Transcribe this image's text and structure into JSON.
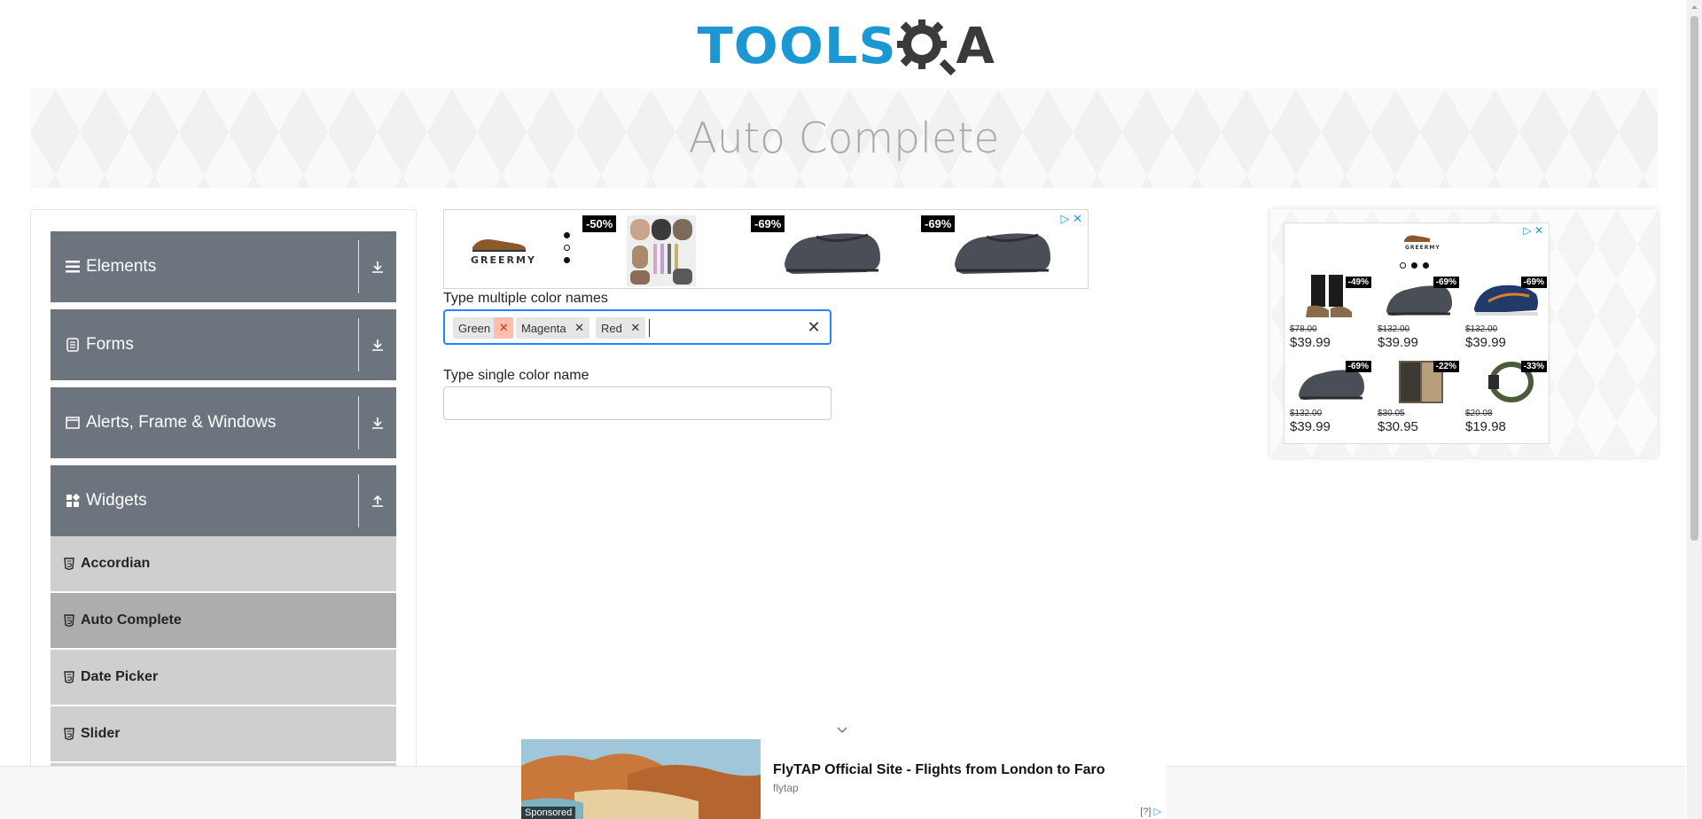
{
  "logo": {
    "text_main": "TOOLS",
    "text_accent": "A"
  },
  "page_title": "Auto Complete",
  "sidebar": {
    "groups": [
      {
        "label": "Elements",
        "icon": "list-icon",
        "arrow": "download-arrow-icon"
      },
      {
        "label": "Forms",
        "icon": "form-icon",
        "arrow": "download-arrow-icon"
      },
      {
        "label": "Alerts, Frame & Windows",
        "icon": "window-icon",
        "arrow": "download-arrow-icon"
      },
      {
        "label": "Widgets",
        "icon": "widgets-icon",
        "arrow": "upload-arrow-icon"
      }
    ],
    "items": [
      {
        "label": "Accordian",
        "active": false
      },
      {
        "label": "Auto Complete",
        "active": true
      },
      {
        "label": "Date Picker",
        "active": false
      },
      {
        "label": "Slider",
        "active": false
      }
    ]
  },
  "top_ad": {
    "brand": "GREERMY",
    "badges": [
      "-50%",
      "-69%",
      "-69%"
    ],
    "adchoice": "▷ ✕"
  },
  "form": {
    "multi_label": "Type multiple color names",
    "chips": [
      "Green",
      "Magenta",
      "Red"
    ],
    "single_label": "Type single color name",
    "single_value": ""
  },
  "right_ad": {
    "brand": "GREERMY",
    "products": [
      {
        "badge": "-49%",
        "old": "$78.00",
        "new": "$39.99"
      },
      {
        "badge": "-69%",
        "old": "$132.00",
        "new": "$39.99"
      },
      {
        "badge": "-69%",
        "old": "$132.00",
        "new": "$39.99"
      },
      {
        "badge": "-69%",
        "old": "$132.00",
        "new": "$39.99"
      },
      {
        "badge": "-22%",
        "old": "$30.05",
        "new": "$30.95"
      },
      {
        "badge": "-33%",
        "old": "$20.08",
        "new": "$19.98"
      }
    ]
  },
  "bottom_ad": {
    "sponsored": "Sponsored",
    "title": "FlyTAP Official Site - Flights from London to Faro",
    "source": "flytap",
    "info": "[?]"
  },
  "colors": {
    "brand_blue": "#1b97d4",
    "sidebar_group": "#6c757d",
    "sidebar_item": "#cfcfcf",
    "sidebar_item_active": "#adadad",
    "focus_border": "#2684ff",
    "chip_remove_hover": "#ffbdad"
  }
}
